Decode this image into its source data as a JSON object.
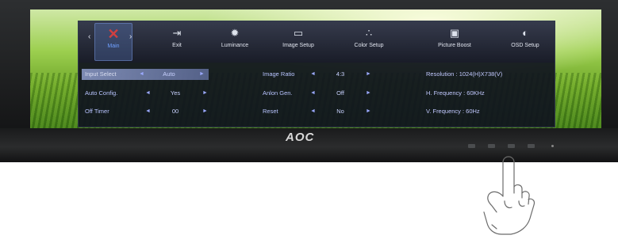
{
  "brand": {
    "logo": "AOC"
  },
  "osd": {
    "tabs": [
      {
        "id": "main",
        "label": "Main",
        "icon": "tools-icon",
        "glyph": "✕",
        "active": true
      },
      {
        "id": "exit",
        "label": "Exit",
        "icon": "exit-icon",
        "glyph": "⇥",
        "active": false
      },
      {
        "id": "luminance",
        "label": "Luminance",
        "icon": "sun-icon",
        "glyph": "✹",
        "active": false
      },
      {
        "id": "image-setup",
        "label": "Image Setup",
        "icon": "image-setup-icon",
        "glyph": "▭",
        "active": false
      },
      {
        "id": "color-setup",
        "label": "Color Setup",
        "icon": "color-setup-icon",
        "glyph": "∴",
        "active": false
      },
      {
        "id": "picture-boost",
        "label": "Picture Boost",
        "icon": "picture-boost-icon",
        "glyph": "▣",
        "active": false
      },
      {
        "id": "osd-setup",
        "label": "OSD Setup",
        "icon": "osd-setup-icon",
        "glyph": "◐",
        "active": false
      }
    ],
    "arrows": {
      "left": "‹",
      "right": "›"
    },
    "left_column": [
      {
        "label": "Input Select",
        "value": "Auto",
        "selected": true
      },
      {
        "label": "Auto Config.",
        "value": "Yes",
        "selected": false
      },
      {
        "label": "Off Timer",
        "value": "00",
        "selected": false
      }
    ],
    "middle_column": [
      {
        "label": "Image Ratio",
        "value": "4:3"
      },
      {
        "label": "Anlon Gen.",
        "value": "Off"
      },
      {
        "label": "Reset",
        "value": "No"
      }
    ],
    "right_column": [
      "Resolution : 1024(H)X738(V)",
      "H. Frequency : 60KHz",
      "V. Frequency : 60Hz"
    ],
    "arrow_left": "◄",
    "arrow_right": "►"
  }
}
